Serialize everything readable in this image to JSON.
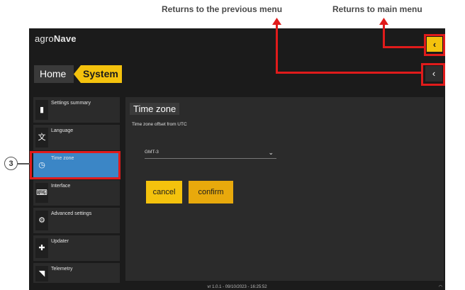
{
  "annotations": {
    "previous": "Returns to the previous menu",
    "main": "Returns to main menu",
    "step": "3"
  },
  "app": {
    "brand_a": "agro",
    "brand_b": "Nave"
  },
  "breadcrumb": {
    "home": "Home",
    "system": "System"
  },
  "buttons": {
    "back": "‹",
    "main": "‹"
  },
  "sidebar": {
    "items": [
      {
        "label": "Settings summary",
        "icon": "bookmark-icon",
        "glyph": "▮"
      },
      {
        "label": "Language",
        "icon": "translate-icon",
        "glyph": "文"
      },
      {
        "label": "Time zone",
        "icon": "clock-icon",
        "glyph": "◷",
        "active": true
      },
      {
        "label": "Interface",
        "icon": "keyboard-icon",
        "glyph": "⌨"
      },
      {
        "label": "Advanced settings",
        "icon": "gears-icon",
        "glyph": "⚙"
      },
      {
        "label": "Updater",
        "icon": "puzzle-icon",
        "glyph": "✚"
      },
      {
        "label": "Telemetry",
        "icon": "signal-icon",
        "glyph": "◥"
      }
    ]
  },
  "panel": {
    "title": "Time zone",
    "subtitle": "Time zone offset from UTC",
    "select_value": "GMT-3",
    "chevron": "⌄",
    "cancel": "cancel",
    "confirm": "confirm"
  },
  "status": {
    "version": "vr 1.0.1 - 09/10/2023 - 16:25:52",
    "wifi": "◠"
  },
  "colors": {
    "accent": "#f4c20d",
    "active": "#3b86c6",
    "highlight": "#e01b1b",
    "bg": "#1b1b1b"
  }
}
